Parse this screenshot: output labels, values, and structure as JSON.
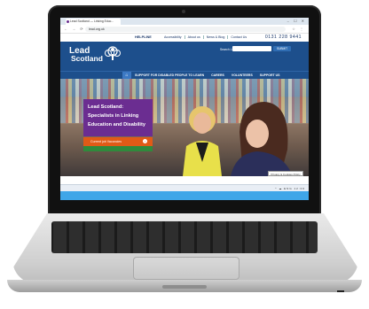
{
  "browser": {
    "tab_title": "Lead Scotland — Linking Educ...",
    "url": "lead.org.uk",
    "nav_icons": "← → ⟳",
    "window_buttons": "– ☐ ✕",
    "right_icons": "☆ ⋮"
  },
  "site": {
    "helpline": "HELPLINE",
    "top_links": [
      "Accessibility",
      "About us",
      "News & Blog",
      "Contact Us"
    ],
    "phone": "0131 228 9441",
    "logo_line1": "Lead",
    "logo_line2": "Scotland",
    "search_label": "Search Lit",
    "search_button": "SUBMIT",
    "home_icon": "⌂",
    "nav": [
      "SUPPORT FOR DISABLED PEOPLE TO LEARN",
      "CARERS",
      "VOLUNTEERS",
      "SUPPORT US"
    ],
    "hero_heading": "Lead Scotland: Specialists in Linking Education and Disability",
    "cta_label": "Current job Vacancies",
    "cta_arrow": "›",
    "notice": "Privacy & Cookies Policy"
  },
  "taskbar": {
    "icons": [
      "#2f6db3",
      "#f2b705",
      "#1c9a4a",
      "#d23b2f",
      "#3a7bd5",
      "#7a3fb0",
      "#0e7ac4",
      "#2d9c8c",
      "#e07a1f",
      "#5560c9",
      "#1d4f8c",
      "#c93c76"
    ],
    "tray": "^ ☁ ENG 12:00"
  },
  "colors": {
    "brand_blue": "#1d4f8c",
    "purple": "#6b2d91",
    "orange": "#e05a17",
    "green": "#2f8a3c"
  }
}
